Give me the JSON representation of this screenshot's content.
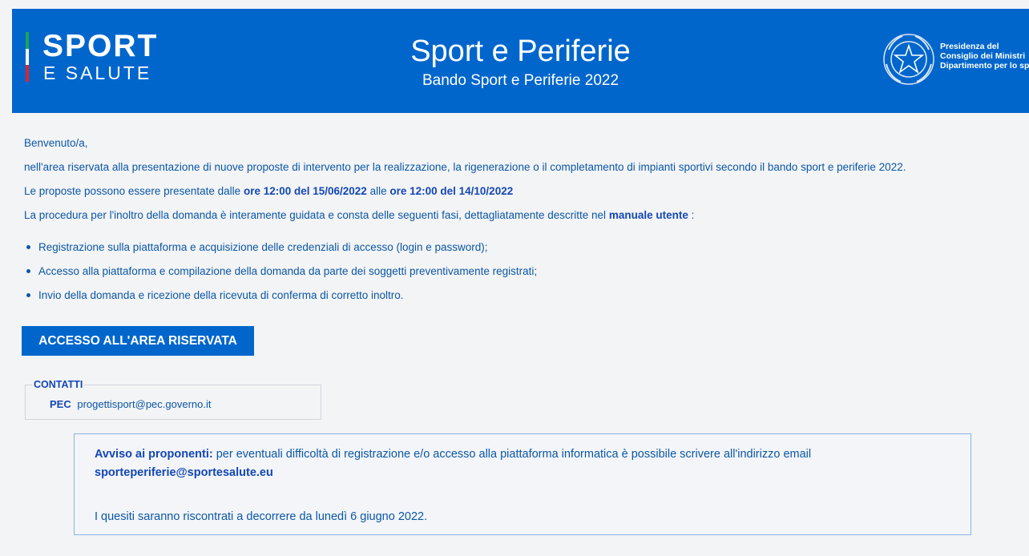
{
  "colors": {
    "brand_blue": "#0066cc",
    "text_blue": "#0b57a6",
    "link_blue": "#1347b5",
    "flag_green": "#1fa350",
    "flag_red": "#d9262e"
  },
  "header": {
    "logo_sport": "SPORT",
    "logo_salute": "E SALUTE",
    "title": "Sport e Periferie",
    "subtitle": "Bando Sport e Periferie 2022",
    "gov_line1": "Presidenza del",
    "gov_line2": "Consiglio dei Ministri",
    "gov_line3": "Dipartimento per lo sport",
    "emblem_icon": "italian-republic-emblem-icon"
  },
  "intro": {
    "greeting": "Benvenuto/a,",
    "description": "nell'area riservata alla presentazione di nuove proposte di intervento per la realizzazione, la rigenerazione o il completamento di impianti sportivi secondo il bando sport e periferie 2022.",
    "dates_prefix": "Le proposte possono essere presentate dalle",
    "date_start": "ore 12:00 del 15/06/2022",
    "dates_mid": "alle",
    "date_end": "ore 12:00 del 14/10/2022",
    "procedure_prefix": "La procedura per l'inoltro della domanda è interamente guidata e consta delle seguenti fasi, dettagliatamente descritte nel",
    "manual_link": "manuale utente",
    "procedure_suffix": ":"
  },
  "steps": [
    "Registrazione sulla piattaforma e acquisizione delle credenziali di accesso (login e password);",
    "Accesso alla piattaforma e compilazione della domanda da parte dei soggetti preventivamente registrati;",
    "Invio della domanda e ricezione della ricevuta di conferma di corretto inoltro."
  ],
  "access_button": "ACCESSO ALL'AREA RISERVATA",
  "contacts": {
    "legend": "CONTATTI",
    "pec_label": "PEC",
    "pec_value": "progettisport@pec.governo.it"
  },
  "notice": {
    "lead": "Avviso ai proponenti:",
    "text": "per eventuali difficoltà di registrazione e/o accesso alla piattaforma informatica è possibile scrivere all'indirizzo email",
    "email": "sporteperiferie@sportesalute.eu",
    "followup": "I quesiti saranno riscontrati a decorrere da lunedì 6 giugno 2022."
  }
}
